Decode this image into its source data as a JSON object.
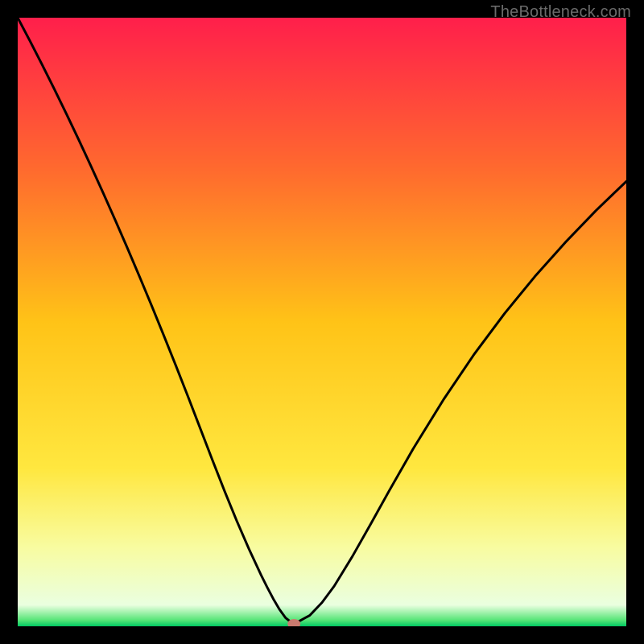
{
  "watermark": "TheBottleneck.com",
  "chart_data": {
    "type": "line",
    "title": "",
    "xlabel": "",
    "ylabel": "",
    "xlim": [
      0,
      100
    ],
    "ylim": [
      0,
      100
    ],
    "x": [
      0,
      2,
      4,
      6,
      8,
      10,
      12,
      14,
      16,
      18,
      20,
      22,
      24,
      26,
      28,
      30,
      32,
      34,
      36,
      38,
      40,
      41,
      42,
      43,
      44,
      45,
      46,
      48,
      50,
      52,
      55,
      58,
      61,
      65,
      70,
      75,
      80,
      85,
      90,
      95,
      100
    ],
    "y": [
      100,
      96.2,
      92.3,
      88.3,
      84.2,
      80.0,
      75.7,
      71.3,
      66.8,
      62.2,
      57.5,
      52.7,
      47.8,
      42.8,
      37.7,
      32.5,
      27.3,
      22.2,
      17.3,
      12.7,
      8.4,
      6.4,
      4.5,
      2.8,
      1.4,
      0.6,
      0.7,
      1.8,
      3.9,
      6.6,
      11.5,
      16.8,
      22.2,
      29.2,
      37.3,
      44.7,
      51.4,
      57.5,
      63.1,
      68.3,
      73.1
    ],
    "marker": {
      "x": 45.4,
      "y": 0.4
    },
    "gradient_stops": [
      {
        "offset": 0.0,
        "color": "#ff1f4b"
      },
      {
        "offset": 0.25,
        "color": "#ff6a2e"
      },
      {
        "offset": 0.5,
        "color": "#ffc317"
      },
      {
        "offset": 0.74,
        "color": "#ffe73f"
      },
      {
        "offset": 0.87,
        "color": "#f8fca0"
      },
      {
        "offset": 0.965,
        "color": "#eaffe0"
      },
      {
        "offset": 0.99,
        "color": "#56e577"
      },
      {
        "offset": 1.0,
        "color": "#00c862"
      }
    ]
  }
}
